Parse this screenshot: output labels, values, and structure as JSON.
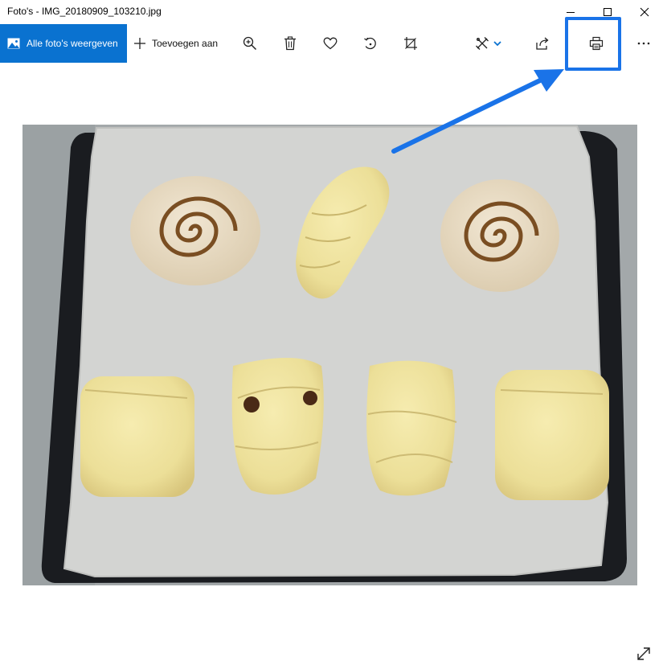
{
  "window": {
    "title": "Foto's - IMG_20180909_103210.jpg",
    "controls": [
      "minimize-icon",
      "maximize-icon",
      "close-icon"
    ]
  },
  "toolbar": {
    "all_photos_label": "Alle foto's weergeven",
    "add_to_label": "Toevoegen aan",
    "icons": [
      "zoom-in-icon",
      "delete-icon",
      "favorite-icon",
      "rotate-icon",
      "crop-icon",
      "edit-draw-icon",
      "chevron-down-icon",
      "share-icon",
      "print-icon",
      "more-icon"
    ],
    "accent_color": "#0a72d0"
  },
  "annotation": {
    "highlight_color": "#1a73e8",
    "target": "print-icon"
  },
  "photo": {
    "subject": "image",
    "background_color": "#9aa0a2"
  }
}
